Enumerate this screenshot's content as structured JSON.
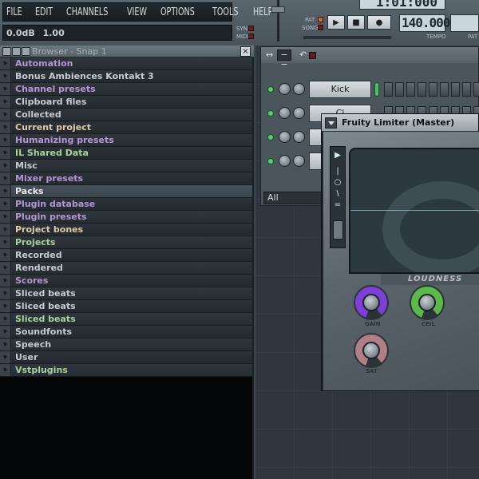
{
  "menu": [
    "FILE",
    "EDIT",
    "CHANNELS",
    "VIEW",
    "OPTIONS",
    "TOOLS",
    "HELP"
  ],
  "hint": {
    "db": "0.0dB",
    "value": "1.00"
  },
  "indicators": {
    "syn": "SYN",
    "midi": "MIDI",
    "pat": "PAT",
    "song": "SONG"
  },
  "transport": {
    "time_display": "1:01:000",
    "tempo": "140.000",
    "tempo_label": "TEMPO",
    "pat_label": "PAT"
  },
  "browser": {
    "title": "Browser - Snap 1",
    "close": "×",
    "items": [
      {
        "label": "Automation",
        "color": "purple"
      },
      {
        "label": "Bonus Ambiences Kontakt 3",
        "color": "gray"
      },
      {
        "label": "Channel presets",
        "color": "purple"
      },
      {
        "label": "Clipboard files",
        "color": "gray"
      },
      {
        "label": "Collected",
        "color": "gray"
      },
      {
        "label": "Current project",
        "color": "tan"
      },
      {
        "label": "Humanizing presets",
        "color": "purple"
      },
      {
        "label": "IL Shared Data",
        "color": "green"
      },
      {
        "label": "Misc",
        "color": "gray"
      },
      {
        "label": "Mixer presets",
        "color": "purple"
      },
      {
        "label": "Packs",
        "color": "white"
      },
      {
        "label": "Plugin database",
        "color": "purple"
      },
      {
        "label": "Plugin presets",
        "color": "purple"
      },
      {
        "label": "Project bones",
        "color": "tan"
      },
      {
        "label": "Projects",
        "color": "green"
      },
      {
        "label": "Recorded",
        "color": "gray"
      },
      {
        "label": "Rendered",
        "color": "gray"
      },
      {
        "label": "Scores",
        "color": "purple"
      },
      {
        "label": "Sliced beats",
        "color": "gray"
      },
      {
        "label": "Sliced beats",
        "color": "gray"
      },
      {
        "label": "Sliced beats",
        "color": "green"
      },
      {
        "label": "Soundfonts",
        "color": "gray"
      },
      {
        "label": "Speech",
        "color": "gray"
      },
      {
        "label": "User",
        "color": "gray"
      },
      {
        "label": "Vstplugins",
        "color": "green"
      }
    ]
  },
  "steprack": {
    "channels": [
      {
        "name": "Kick"
      },
      {
        "name": "Cl"
      },
      {
        "name": ""
      },
      {
        "name": ""
      }
    ],
    "filter": "All"
  },
  "limiter": {
    "title": "Fruity Limiter (Master)",
    "section": "LOUDNESS",
    "knobs": [
      {
        "label": "GAIN",
        "color": "#7c3fd8"
      },
      {
        "label": "CEIL",
        "color": "#5bb94a"
      },
      {
        "label": "SAT",
        "color": "#b07f86"
      }
    ]
  }
}
